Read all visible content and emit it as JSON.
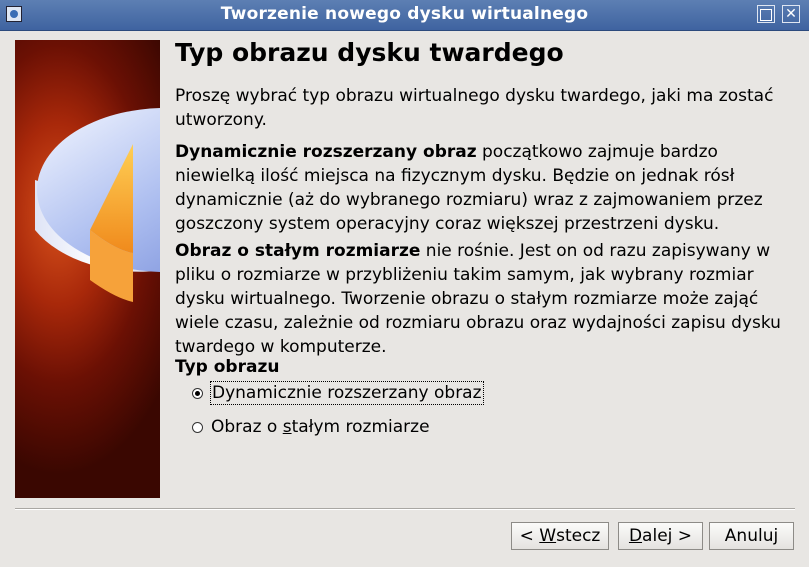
{
  "window": {
    "title": "Tworzenie nowego dysku wirtualnego",
    "maximize_icon": "maximize-icon",
    "close_icon": "close-icon"
  },
  "page": {
    "heading": "Typ obrazu dysku twardego",
    "intro": "Proszę wybrać typ obrazu wirtualnego dysku twardego, jaki ma zostać utworzony.",
    "dynamic_bold": "Dynamicznie rozszerzany obraz",
    "dynamic_text": " początkowo zajmuje bardzo niewielką ilość miejsca na fizycznym dysku. Będzie on jednak rósł dynamicznie (aż do wybranego rozmiaru) wraz z zajmowaniem przez goszczony system operacyjny coraz większej przestrzeni dysku.",
    "fixed_bold": "Obraz o stałym rozmiarze",
    "fixed_text": " nie rośnie. Jest on od razu zapisywany w pliku o rozmiarze w przybliżeniu takim samym, jak wybrany rozmiar dysku wirtualnego. Tworzenie obrazu o stałym rozmiarze może zająć wiele czasu, zależnie od rozmiaru obrazu oraz wydajności zapisu dysku twardego w komputerze."
  },
  "image_type": {
    "label": "Typ obrazu",
    "options": [
      {
        "label": "Dynamicznie rozszerzany obraz",
        "selected": true
      },
      {
        "label_before": "Obraz o ",
        "label_mnemonic": "s",
        "label_after": "tałym rozmiarze",
        "selected": false
      }
    ]
  },
  "buttons": {
    "back_prefix": "< ",
    "back_mnemonic": "W",
    "back_rest": "stecz",
    "next_mnemonic": "D",
    "next_rest": "alej >",
    "cancel": "Anuluj"
  },
  "colors": {
    "titlebar": "#4a6ea9",
    "sidebar": "#8a1a06",
    "background": "#e8e6e3"
  }
}
